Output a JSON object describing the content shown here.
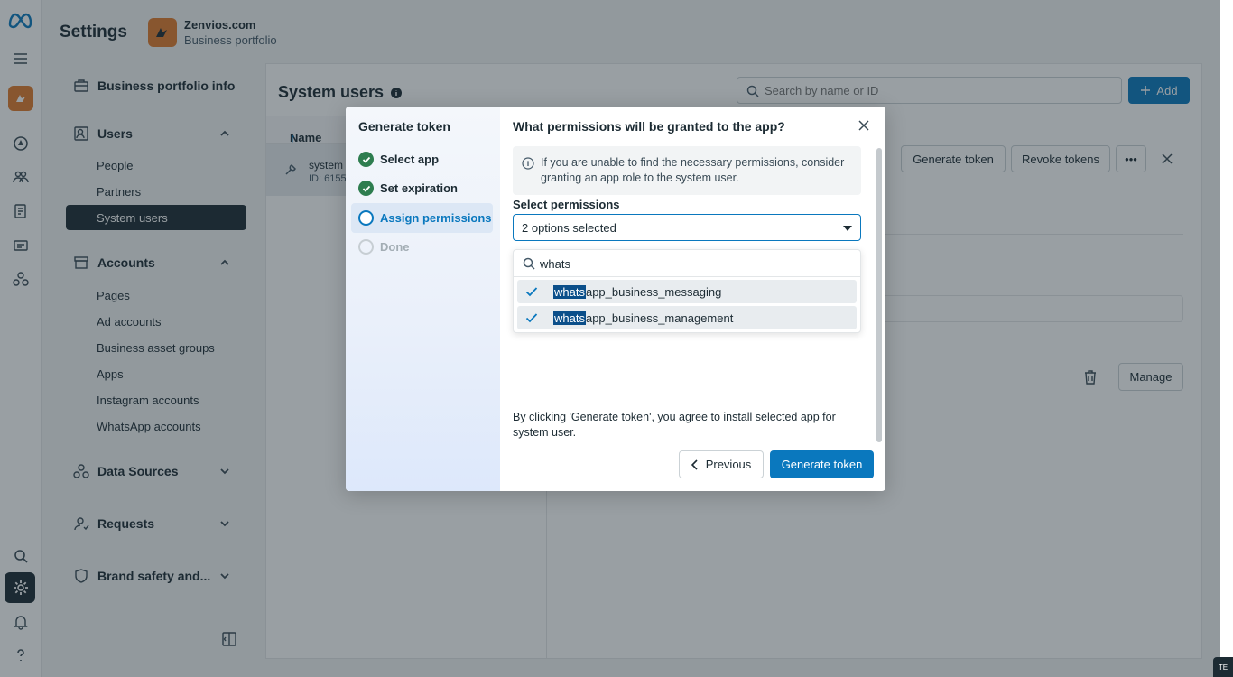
{
  "topbar": {
    "title": "Settings",
    "portfolio_name": "Zenvios.com",
    "portfolio_sub": "Business portfolio"
  },
  "sidenav": {
    "business_info": "Business portfolio info",
    "users": "Users",
    "users_items": [
      "People",
      "Partners"
    ],
    "users_active": "System users",
    "accounts": "Accounts",
    "accounts_items": [
      "Pages",
      "Ad accounts",
      "Business asset groups",
      "Apps",
      "Instagram accounts",
      "WhatsApp accounts"
    ],
    "data_sources": "Data Sources",
    "requests": "Requests",
    "brand_safety": "Brand safety and..."
  },
  "main": {
    "title": "System users",
    "search_placeholder": "Search by name or ID",
    "add_label": "Add",
    "col_name": "Name",
    "row_name": "system",
    "row_id": "ID: 6155",
    "generate_token": "Generate token",
    "revoke_tokens": "Revoke tokens",
    "manage": "Manage"
  },
  "modal": {
    "steps_title": "Generate token",
    "steps": [
      "Select app",
      "Set expiration",
      "Assign permissions",
      "Done"
    ],
    "title": "What permissions will be granted to the app?",
    "info": "If you are unable to find the necessary permissions, consider granting an app role to the system user.",
    "select_label": "Select permissions",
    "selected_summary": "2 options selected",
    "search_value": "whats",
    "options": [
      {
        "match": "whats",
        "rest": "app_business_messaging"
      },
      {
        "match": "whats",
        "rest": "app_business_management"
      }
    ],
    "agreement": "By clicking 'Generate token', you agree to install selected app for system user.",
    "previous": "Previous",
    "generate": "Generate token"
  },
  "corner_chip": "TE",
  "colors": {
    "accent": "#0a78be",
    "done_green": "#2e7d4f",
    "dark": "#1c2b33",
    "highlight": "#0b4f8a"
  }
}
